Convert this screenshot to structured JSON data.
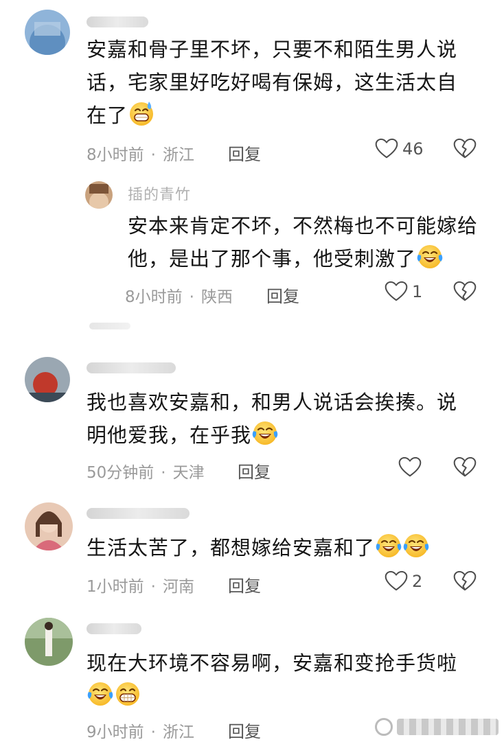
{
  "comments": [
    {
      "username": "",
      "text_lines": [
        "安嘉和骨子里不坏，只要不和陌生男人说",
        "话，宅家里好吃好喝有保姆，这生活太自",
        "在了"
      ],
      "emojis": [
        "grinning-sweat-emoji"
      ],
      "time": "8小时前",
      "location": "浙江",
      "reply_label": "回复",
      "likes": "46"
    },
    {
      "username": "插的青竹",
      "text_lines": [
        "安本来肯定不坏，不然梅也不可能嫁给",
        "他，是出了那个事，他受刺激了"
      ],
      "emojis": [
        "crying-laughing-emoji"
      ],
      "time": "8小时前",
      "location": "陕西",
      "reply_label": "回复",
      "likes": "1"
    },
    {
      "username": "",
      "text_lines": [
        "我也喜欢安嘉和，和男人说话会挨揍。说",
        "明他爱我，在乎我"
      ],
      "emojis": [
        "crying-laughing-emoji"
      ],
      "time": "50分钟前",
      "location": "天津",
      "reply_label": "回复",
      "likes": ""
    },
    {
      "username": "",
      "text_lines": [
        "生活太苦了，都想嫁给安嘉和了"
      ],
      "emojis": [
        "crying-laughing-emoji",
        "crying-laughing-emoji"
      ],
      "time": "1小时前",
      "location": "河南",
      "reply_label": "回复",
      "likes": "2"
    },
    {
      "username": "",
      "text_lines": [
        "现在大环境不容易啊，安嘉和变抢手货啦"
      ],
      "emojis": [
        "crying-laughing-emoji",
        "grinning-emoji"
      ],
      "time": "9小时前",
      "location": "浙江",
      "reply_label": "回复",
      "likes": ""
    }
  ],
  "meta_separator": "·",
  "icons": {
    "like": "heart-outline-icon",
    "dislike": "broken-heart-icon"
  },
  "colors": {
    "text": "#161616",
    "meta": "#9a9a9a",
    "icon": "#555555"
  }
}
